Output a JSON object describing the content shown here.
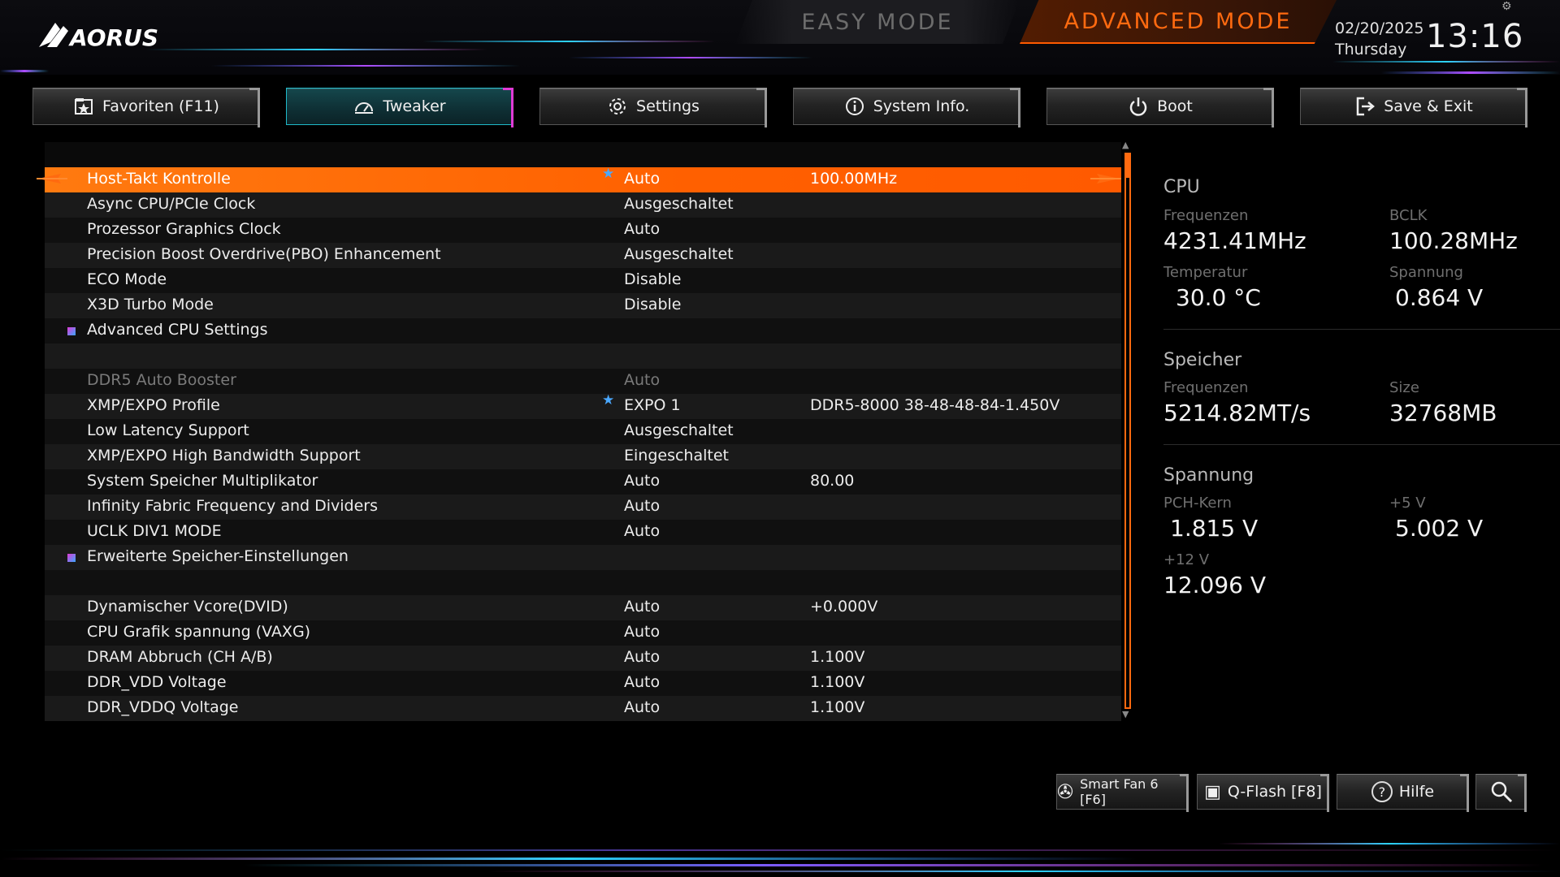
{
  "header": {
    "logo_text": "AORUS",
    "mode_easy": "EASY MODE",
    "mode_advanced": "ADVANCED MODE",
    "date": "02/20/2025",
    "weekday": "Thursday",
    "time": "13:16"
  },
  "tabs": [
    {
      "label": "Favoriten (F11)",
      "icon": "favorites-icon"
    },
    {
      "label": "Tweaker",
      "icon": "speedometer-icon",
      "active": true
    },
    {
      "label": "Settings",
      "icon": "gear-icon"
    },
    {
      "label": "System Info.",
      "icon": "info-icon"
    },
    {
      "label": "Boot",
      "icon": "power-icon"
    },
    {
      "label": "Save & Exit",
      "icon": "exit-icon"
    }
  ],
  "settings": [
    {
      "label": "Host-Takt Kontrolle",
      "value": "Auto",
      "value2": "100.00MHz",
      "starred": true,
      "selected": true
    },
    {
      "label": "Async CPU/PCIe Clock",
      "value": "Ausgeschaltet",
      "value2": ""
    },
    {
      "label": "Prozessor Graphics Clock",
      "value": "Auto",
      "value2": ""
    },
    {
      "label": "Precision Boost Overdrive(PBO) Enhancement",
      "value": "Ausgeschaltet",
      "value2": ""
    },
    {
      "label": "ECO Mode",
      "value": "Disable",
      "value2": ""
    },
    {
      "label": "X3D Turbo Mode",
      "value": "Disable",
      "value2": ""
    },
    {
      "label": "Advanced CPU Settings",
      "value": "",
      "value2": "",
      "submenu": true
    },
    {
      "label": "",
      "value": "",
      "value2": ""
    },
    {
      "label": "DDR5 Auto Booster",
      "value": "Auto",
      "value2": "",
      "disabled": true
    },
    {
      "label": "XMP/EXPO Profile",
      "value": "EXPO 1",
      "value2": "DDR5-8000 38-48-48-84-1.450V",
      "starred": true
    },
    {
      "label": "Low Latency Support",
      "value": "Ausgeschaltet",
      "value2": ""
    },
    {
      "label": "XMP/EXPO High Bandwidth Support",
      "value": "Eingeschaltet",
      "value2": ""
    },
    {
      "label": "System Speicher Multiplikator",
      "value": "Auto",
      "value2": "80.00"
    },
    {
      "label": "Infinity Fabric Frequency and Dividers",
      "value": "Auto",
      "value2": ""
    },
    {
      "label": "UCLK DIV1 MODE",
      "value": "Auto",
      "value2": ""
    },
    {
      "label": "Erweiterte Speicher-Einstellungen",
      "value": "",
      "value2": "",
      "submenu": true
    },
    {
      "label": "",
      "value": "",
      "value2": ""
    },
    {
      "label": "Dynamischer Vcore(DVID)",
      "value": "Auto",
      "value2": "+0.000V"
    },
    {
      "label": "CPU Grafik spannung (VAXG)",
      "value": "Auto",
      "value2": ""
    },
    {
      "label": "DRAM Abbruch  (CH A/B)",
      "value": "Auto",
      "value2": "1.100V"
    },
    {
      "label": "DDR_VDD Voltage",
      "value": "Auto",
      "value2": "1.100V"
    },
    {
      "label": "DDR_VDDQ Voltage",
      "value": "Auto",
      "value2": "1.100V"
    }
  ],
  "info": {
    "cpu": {
      "title": "CPU",
      "freq_label": "Frequenzen",
      "freq": "4231.41MHz",
      "bclk_label": "BCLK",
      "bclk": "100.28MHz",
      "temp_label": "Temperatur",
      "temp": "30.0 °C",
      "volt_label": "Spannung",
      "volt": "0.864 V"
    },
    "memory": {
      "title": "Speicher",
      "freq_label": "Frequenzen",
      "freq": "5214.82MT/s",
      "size_label": "Size",
      "size": "32768MB"
    },
    "voltage": {
      "title": "Spannung",
      "pch_label": "PCH-Kern",
      "pch": "1.815 V",
      "v5_label": "+5 V",
      "v5": "5.002 V",
      "v12_label": "+12 V",
      "v12": "12.096 V"
    }
  },
  "bottom_buttons": {
    "smartfan": "Smart Fan 6 [F6]",
    "qflash": "Q-Flash [F8]",
    "help": "Hilfe"
  },
  "colors": {
    "accent_orange": "#ff6000",
    "tab_active_cyan": "#1fb9c9",
    "tab_active_magenta": "#e03bd6",
    "star_blue": "#4aa8ff"
  }
}
